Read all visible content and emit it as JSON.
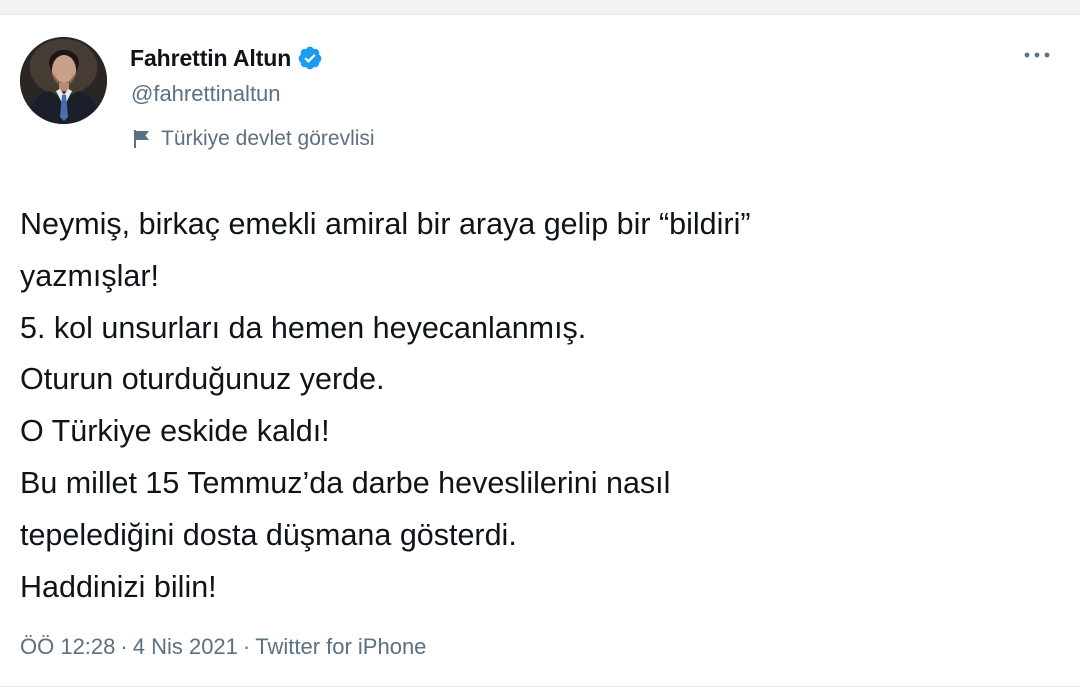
{
  "tweet": {
    "author": {
      "display_name": "Fahrettin Altun",
      "handle": "@fahrettinaltun",
      "label": "Türkiye devlet görevlisi",
      "avatar_icon": "person-photo",
      "verified_icon": "verified-badge-icon",
      "label_icon": "flag-icon"
    },
    "more_icon": "more-options-icon",
    "text_lines": [
      "Neymiş, birkaç emekli amiral bir araya gelip bir “bildiri”",
      "yazmışlar!",
      "5. kol unsurları da hemen heyecanlanmış.",
      "Oturun oturduğunuz yerde.",
      "O Türkiye eskide kaldı!",
      "Bu millet 15 Temmuz’da darbe heveslilerini nasıl",
      "tepelediğini dosta düşmana gösterdi.",
      "Haddinizi bilin!"
    ],
    "meta": {
      "time": "ÖÖ 12:28",
      "separator": "·",
      "date": "4 Nis 2021",
      "source": "Twitter for iPhone"
    }
  },
  "colors": {
    "text": "#0f1419",
    "secondary": "#5b7083",
    "verified": "#1d9bf0",
    "background": "#ffffff"
  }
}
